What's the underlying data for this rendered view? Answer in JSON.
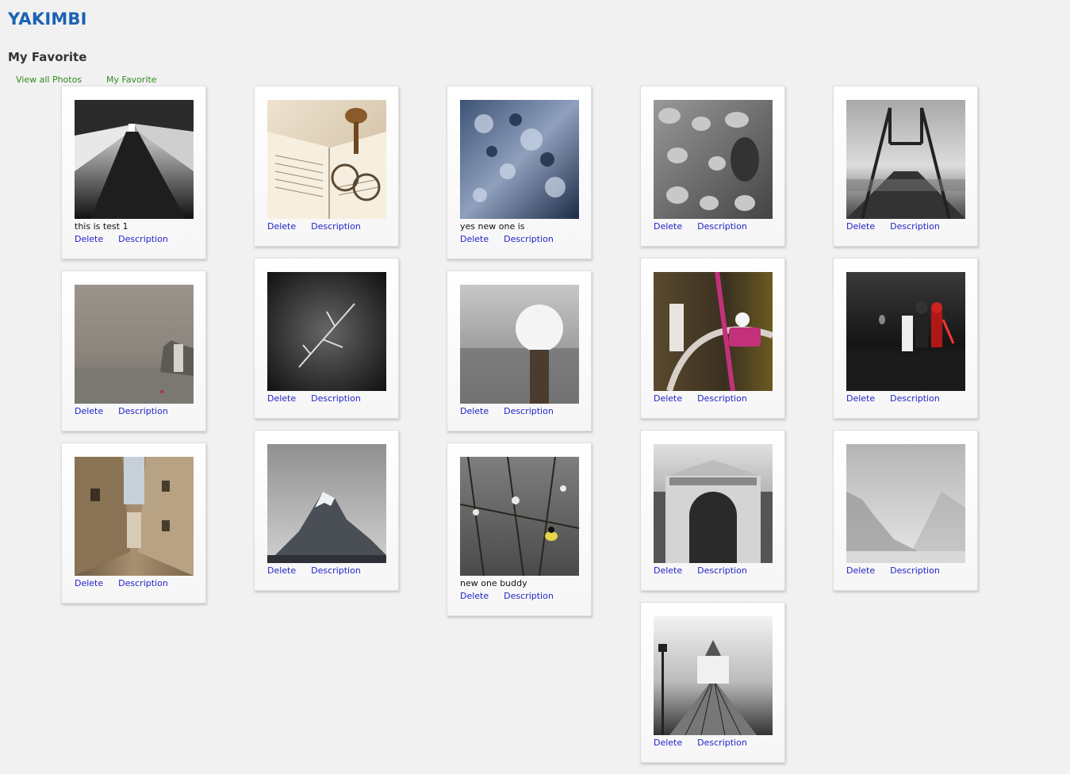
{
  "brand": "YAKIMBI",
  "page_title": "My Favorite",
  "nav": [
    {
      "label": "View all Photos"
    },
    {
      "label": "My Favorite"
    }
  ],
  "actions": {
    "delete": "Delete",
    "description": "Description"
  },
  "columns": [
    [
      {
        "photo": "tunnel-stairs",
        "caption": "this is test 1"
      },
      {
        "photo": "foggy-lake-castle",
        "caption": ""
      },
      {
        "photo": "narrow-alley",
        "caption": ""
      }
    ],
    [
      {
        "photo": "book-glasses",
        "caption": ""
      },
      {
        "photo": "dark-branch",
        "caption": ""
      },
      {
        "photo": "mountain-peak",
        "caption": ""
      }
    ],
    [
      {
        "photo": "blue-ice",
        "caption": "yes new one is"
      },
      {
        "photo": "snow-post",
        "caption": ""
      },
      {
        "photo": "bird-branches",
        "caption": "new one buddy"
      }
    ],
    [
      {
        "photo": "stones-bird",
        "caption": ""
      },
      {
        "photo": "pink-bicycle",
        "caption": ""
      },
      {
        "photo": "gate-arch",
        "caption": ""
      },
      {
        "photo": "bridge-castle",
        "caption": ""
      }
    ],
    [
      {
        "photo": "bridge-structure",
        "caption": ""
      },
      {
        "photo": "lego-starwars",
        "caption": ""
      },
      {
        "photo": "misty-forest",
        "caption": ""
      }
    ]
  ]
}
